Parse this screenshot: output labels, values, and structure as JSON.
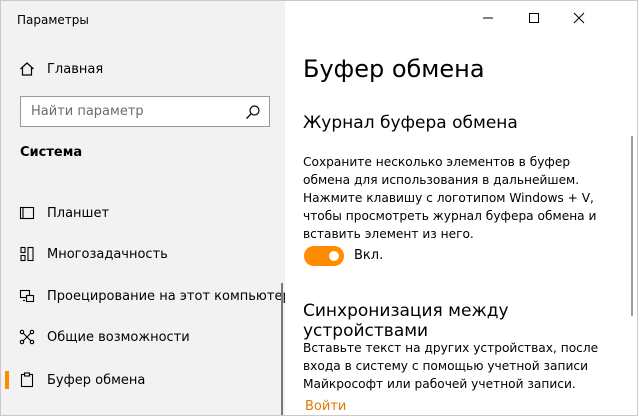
{
  "window": {
    "title": "Параметры"
  },
  "sidebar": {
    "home_label": "Главная",
    "search_placeholder": "Найти параметр",
    "section_title": "Система",
    "items": [
      {
        "label": "Планшет",
        "icon": "tablet-icon"
      },
      {
        "label": "Многозадачность",
        "icon": "multitasking-icon"
      },
      {
        "label": "Проецирование на этот компьютер",
        "icon": "projecting-icon"
      },
      {
        "label": "Общие возможности",
        "icon": "shared-experiences-icon"
      },
      {
        "label": "Буфер обмена",
        "icon": "clipboard-icon",
        "selected": true
      }
    ]
  },
  "main": {
    "title": "Буфер обмена",
    "history": {
      "heading": "Журнал буфера обмена",
      "description": "Сохраните несколько элементов в буфер обмена для использования в дальнейшем. Нажмите клавишу с логотипом Windows + V, чтобы просмотреть журнал буфера обмена и вставить элемент из него.",
      "toggle_label": "Вкл.",
      "toggle_on": true
    },
    "sync": {
      "heading": "Синхронизация между устройствами",
      "description": "Вставьте текст на других устройствах, после входа в систему с помощью учетной записи Майкрософт или рабочей учетной записи.",
      "link": "Войти"
    }
  },
  "colors": {
    "accent": "#ff8c00",
    "sidebar_bg": "#f2f2f2",
    "link": "#e07b00"
  }
}
